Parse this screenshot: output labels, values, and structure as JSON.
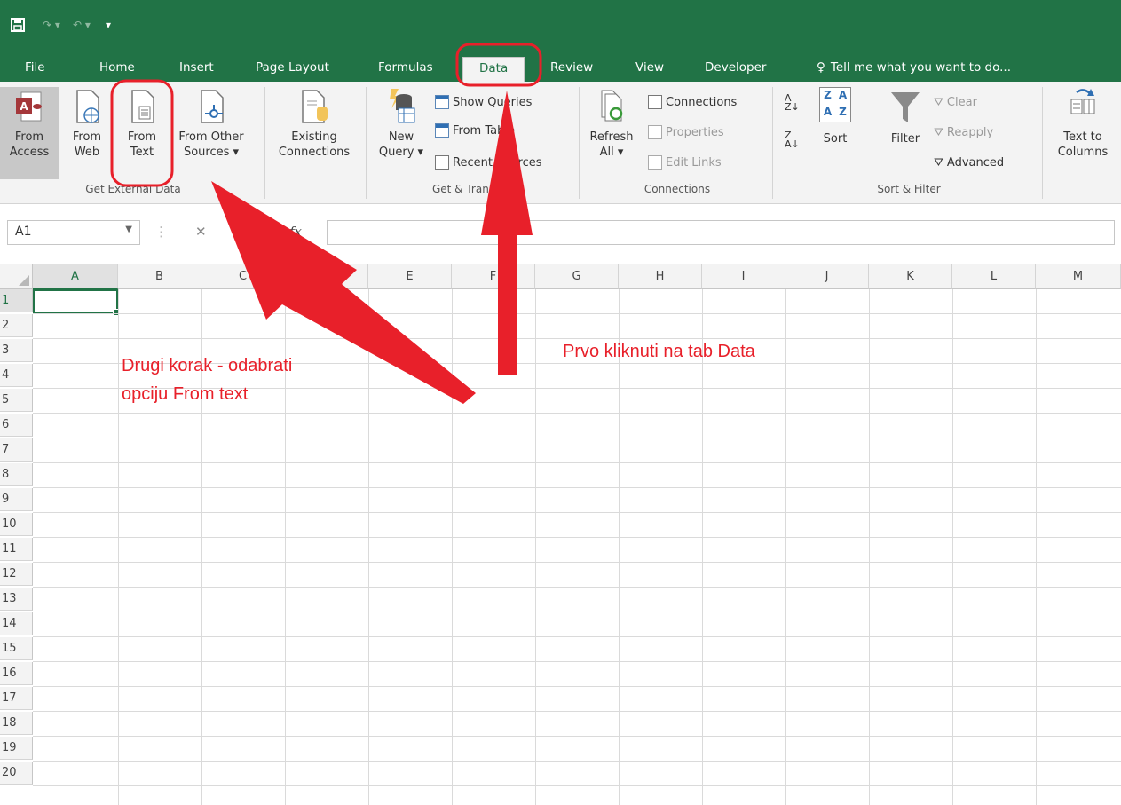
{
  "tabs": [
    {
      "label": "File",
      "active": false
    },
    {
      "label": "Home",
      "active": false
    },
    {
      "label": "Insert",
      "active": false
    },
    {
      "label": "Page Layout",
      "active": false
    },
    {
      "label": "Formulas",
      "active": false
    },
    {
      "label": "Data",
      "active": true
    },
    {
      "label": "Review",
      "active": false
    },
    {
      "label": "View",
      "active": false
    },
    {
      "label": "Developer",
      "active": false
    }
  ],
  "tell_me": "Tell me what you want to do...",
  "ribbon": {
    "from_access": [
      "From",
      "Access"
    ],
    "from_web": [
      "From",
      "Web"
    ],
    "from_text": [
      "From",
      "Text"
    ],
    "from_other": [
      "From Other",
      "Sources ▾"
    ],
    "existing": [
      "Existing",
      "Connections"
    ],
    "new_query": [
      "New",
      "Query ▾"
    ],
    "show_queries": "Show Queries",
    "from_table": "From Table",
    "recent_sources": "Recent Sources",
    "refresh": [
      "Refresh",
      "All ▾"
    ],
    "connections": "Connections",
    "properties": "Properties",
    "edit_links": "Edit Links",
    "sort": "Sort",
    "filter": "Filter",
    "clear": "Clear",
    "reapply": "Reapply",
    "advanced": "Advanced",
    "text_to_columns": [
      "Text to",
      "Columns"
    ],
    "groups": {
      "get_external": "Get External Data",
      "get_transform": "Get & Transform",
      "connections": "Connections",
      "sort_filter": "Sort & Filter"
    }
  },
  "formula_bar": {
    "name_box": "A1",
    "fx": "fx",
    "value": ""
  },
  "columns": [
    "A",
    "B",
    "C",
    "D",
    "E",
    "F",
    "G",
    "H",
    "I",
    "J",
    "K",
    "L",
    "M"
  ],
  "rows": [
    "1",
    "2",
    "3",
    "4",
    "5",
    "6",
    "7",
    "8",
    "9",
    "10",
    "11",
    "12",
    "13",
    "14",
    "15",
    "16",
    "17",
    "18",
    "19",
    "20"
  ],
  "annotations": {
    "step2_line1": "Drugi korak - odabrati",
    "step2_line2": "opciju From text",
    "step1": "Prvo kliknuti na tab Data"
  },
  "colors": {
    "excel_green": "#217346",
    "annotation_red": "#e8202a"
  }
}
